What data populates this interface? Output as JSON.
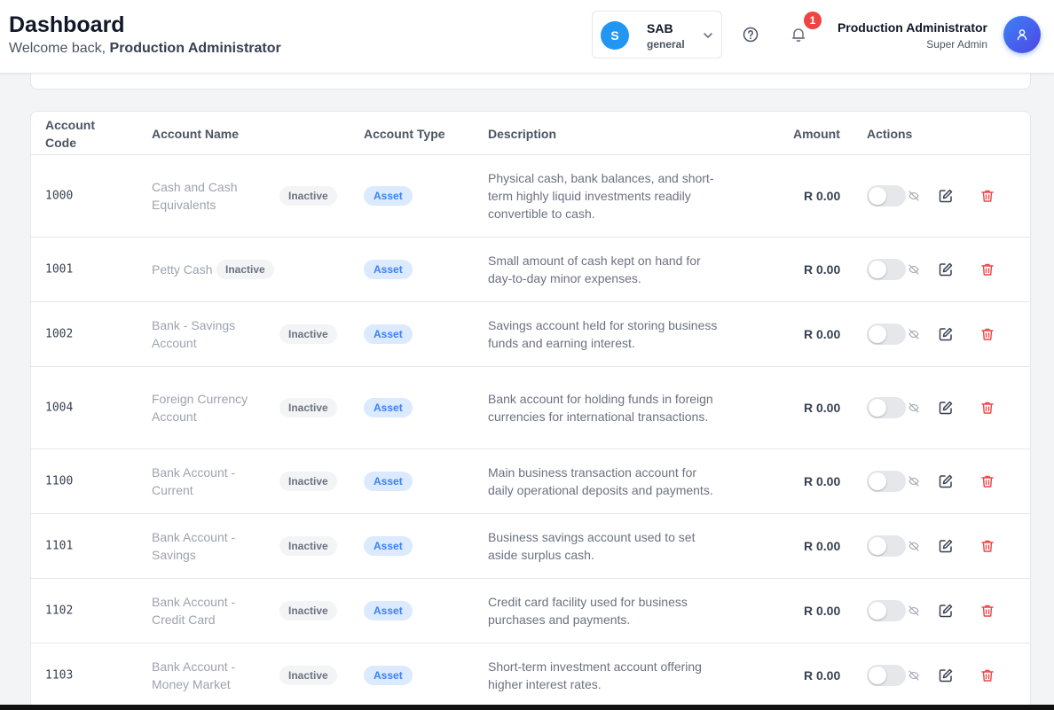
{
  "header": {
    "title": "Dashboard",
    "welcome_prefix": "Welcome back,",
    "welcome_user": "Production Administrator",
    "company": {
      "initial": "S",
      "name": "SAB",
      "subtitle": "general"
    },
    "notifications_count": "1",
    "user": {
      "name": "Production Administrator",
      "role": "Super Admin"
    }
  },
  "table": {
    "headers": {
      "code_line1": "Account",
      "code_line2": "Code",
      "name": "Account Name",
      "type": "Account Type",
      "description": "Description",
      "amount": "Amount",
      "actions": "Actions"
    },
    "rows": [
      {
        "code": "1000",
        "name": "Cash and Cash Equivalents",
        "status": "Inactive",
        "type": "Asset",
        "description": "Physical cash, bank balances, and short-term highly liquid investments readily convertible to cash.",
        "amount": "R 0.00",
        "active": false
      },
      {
        "code": "1001",
        "name": "Petty Cash",
        "status": "Inactive",
        "type": "Asset",
        "description": "Small amount of cash kept on hand for day-to-day minor expenses.",
        "amount": "R 0.00",
        "active": false
      },
      {
        "code": "1002",
        "name": "Bank - Savings Account",
        "status": "Inactive",
        "type": "Asset",
        "description": "Savings account held for storing business funds and earning interest.",
        "amount": "R 0.00",
        "active": false
      },
      {
        "code": "1004",
        "name": "Foreign Currency Account",
        "status": "Inactive",
        "type": "Asset",
        "description": "Bank account for holding funds in foreign currencies for international transactions.",
        "amount": "R 0.00",
        "active": false
      },
      {
        "code": "1100",
        "name": "Bank Account - Current",
        "status": "Inactive",
        "type": "Asset",
        "description": "Main business transaction account for daily operational deposits and payments.",
        "amount": "R 0.00",
        "active": false
      },
      {
        "code": "1101",
        "name": "Bank Account - Savings",
        "status": "Inactive",
        "type": "Asset",
        "description": "Business savings account used to set aside surplus cash.",
        "amount": "R 0.00",
        "active": false
      },
      {
        "code": "1102",
        "name": "Bank Account - Credit Card",
        "status": "Inactive",
        "type": "Asset",
        "description": "Credit card facility used for business purchases and payments.",
        "amount": "R 0.00",
        "active": false
      },
      {
        "code": "1103",
        "name": "Bank Account - Money Market",
        "status": "Inactive",
        "type": "Asset",
        "description": "Short-term investment account offering higher interest rates.",
        "amount": "R 0.00",
        "active": false
      }
    ]
  },
  "colors": {
    "accent": "#3b82f6",
    "badge_red": "#ef4444",
    "delete_red": "#ef4444"
  },
  "icons": [
    "chevron-down-icon",
    "help-circle-icon",
    "bell-icon",
    "user-icon",
    "eye-off-icon",
    "edit-icon",
    "trash-icon"
  ]
}
